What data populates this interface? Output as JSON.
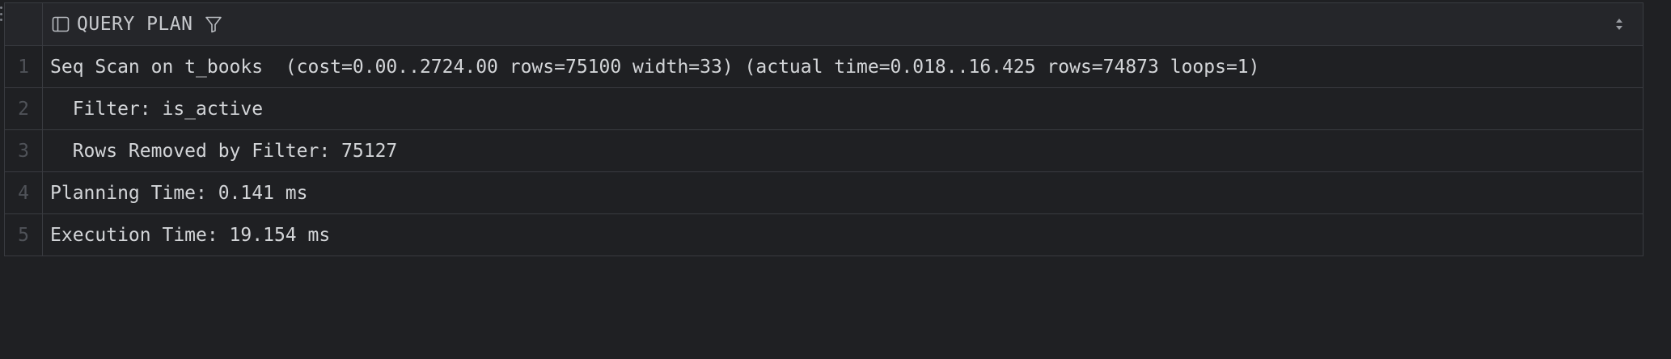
{
  "column": {
    "title": "QUERY PLAN",
    "icon": "column-layout-icon",
    "filter_icon": "filter-icon",
    "sort_icon": "sort-updown-icon"
  },
  "rows": [
    {
      "num": "1",
      "text": "Seq Scan on t_books  (cost=0.00..2724.00 rows=75100 width=33) (actual time=0.018..16.425 rows=74873 loops=1)"
    },
    {
      "num": "2",
      "text": "  Filter: is_active"
    },
    {
      "num": "3",
      "text": "  Rows Removed by Filter: 75127"
    },
    {
      "num": "4",
      "text": "Planning Time: 0.141 ms"
    },
    {
      "num": "5",
      "text": "Execution Time: 19.154 ms"
    }
  ],
  "colors": {
    "background": "#1f2023",
    "header_background": "#25262a",
    "border": "#393b40",
    "text": "#d3d5d8",
    "line_number": "#4f5258"
  }
}
